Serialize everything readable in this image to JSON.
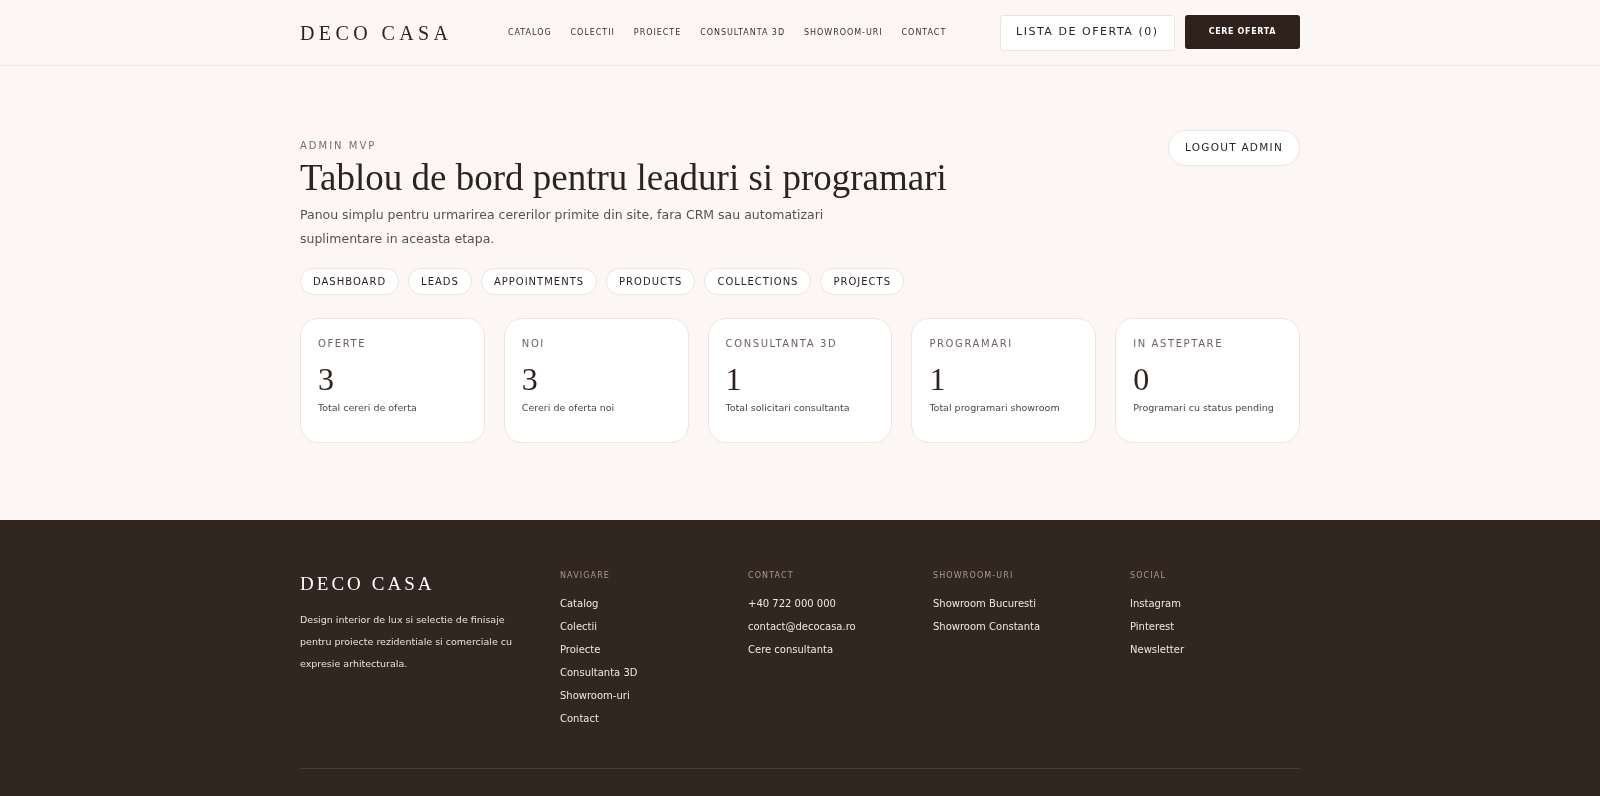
{
  "header": {
    "logo": "DECO CASA",
    "nav": [
      "CATALOG",
      "COLECTII",
      "PROIECTE",
      "CONSULTANTA 3D",
      "SHOWROOM-URI",
      "CONTACT"
    ],
    "quote_list_button": "LISTA DE OFERTA (0)",
    "quote_button": "CERE OFERTA"
  },
  "hero": {
    "eyebrow": "ADMIN MVP",
    "title": "Tablou de bord pentru leaduri si programari",
    "description": "Panou simplu pentru urmarirea cererilor primite din site, fara CRM sau automatizari suplimentare in aceasta etapa.",
    "logout_button": "LOGOUT ADMIN"
  },
  "tabs": [
    "DASHBOARD",
    "LEADS",
    "APPOINTMENTS",
    "PRODUCTS",
    "COLLECTIONS",
    "PROJECTS"
  ],
  "stats": [
    {
      "label": "OFERTE",
      "value": "3",
      "caption": "Total cereri de oferta"
    },
    {
      "label": "NOI",
      "value": "3",
      "caption": "Cereri de oferta noi"
    },
    {
      "label": "CONSULTANTA 3D",
      "value": "1",
      "caption": "Total solicitari consultanta"
    },
    {
      "label": "PROGRAMARI",
      "value": "1",
      "caption": "Total programari showroom"
    },
    {
      "label": "IN ASTEPTARE",
      "value": "0",
      "caption": "Programari cu status pending"
    }
  ],
  "footer": {
    "logo": "DECO CASA",
    "tagline": "Design interior de lux si selectie de finisaje pentru proiecte rezidentiale si comerciale cu expresie arhitecturala.",
    "columns": [
      {
        "heading": "NAVIGARE",
        "links": [
          "Catalog",
          "Colectii",
          "Proiecte",
          "Consultanta 3D",
          "Showroom-uri",
          "Contact"
        ]
      },
      {
        "heading": "CONTACT",
        "links": [
          "+40 722 000 000",
          "contact@decocasa.ro",
          "Cere consultanta"
        ]
      },
      {
        "heading": "SHOWROOM-URI",
        "links": [
          "Showroom Bucuresti",
          "Showroom Constanta"
        ]
      },
      {
        "heading": "SOCIAL",
        "links": [
          "Instagram",
          "Pinterest",
          "Newsletter"
        ]
      }
    ]
  }
}
